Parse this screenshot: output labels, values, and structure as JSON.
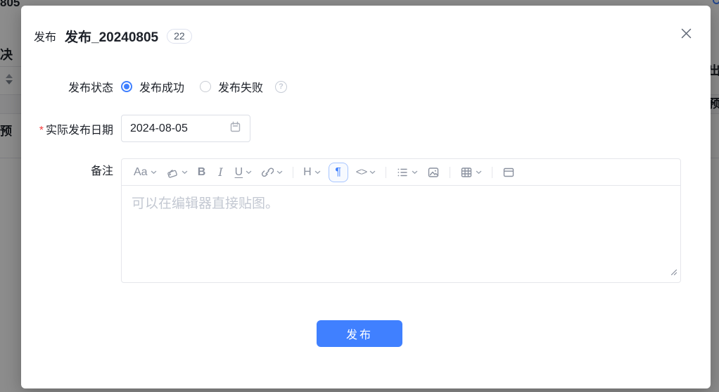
{
  "background": {
    "fragment_top_left": "805",
    "fragment_left_row1": "决",
    "fragment_left_row2": "预",
    "fragment_right_row1": "出",
    "fragment_right_row2": "预"
  },
  "modal": {
    "title_prefix": "发布",
    "title": "发布_20240805",
    "badge_count": "22"
  },
  "form": {
    "status": {
      "label": "发布状态",
      "options": [
        {
          "label": "发布成功",
          "selected": true
        },
        {
          "label": "发布失败",
          "selected": false
        }
      ]
    },
    "date": {
      "label": "实际发布日期",
      "required_mark": "*",
      "value": "2024-08-05"
    },
    "remark": {
      "label": "备注",
      "placeholder": "可以在编辑器直接贴图。"
    }
  },
  "toolbar": {
    "font_label": "Aa",
    "bold_label": "B",
    "italic_label": "I",
    "underline_label": "U",
    "heading_label": "H",
    "paragraph_label": "¶",
    "code_label": "<>"
  },
  "footer": {
    "submit_label": "发布"
  },
  "colors": {
    "primary": "#4080ff",
    "text_main": "#1d2129",
    "icon_gray": "#8a919f",
    "border": "#e5e6eb",
    "overlay": "rgba(0,0,0,0.45)"
  }
}
